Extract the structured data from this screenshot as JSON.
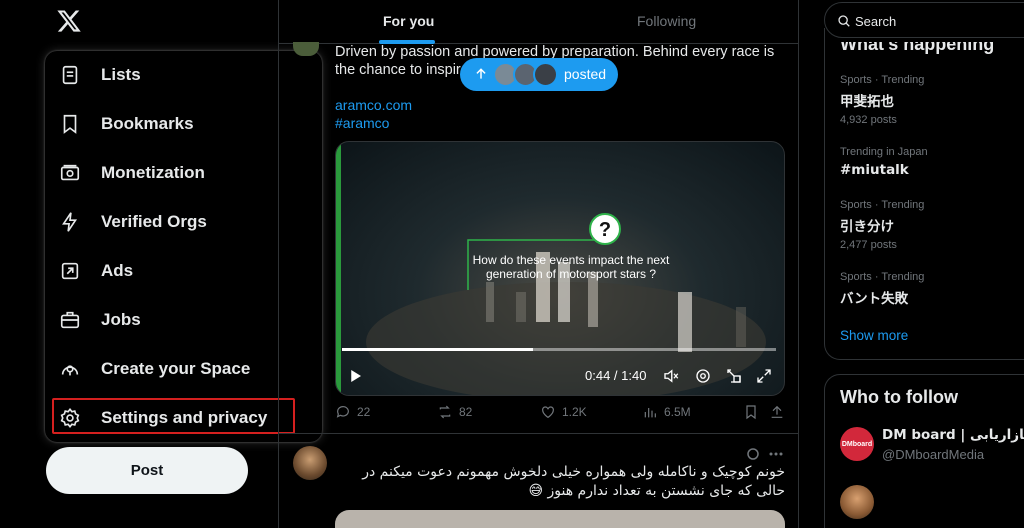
{
  "menu": {
    "items": [
      {
        "label": "Lists",
        "icon": "list-icon"
      },
      {
        "label": "Bookmarks",
        "icon": "bookmark-icon"
      },
      {
        "label": "Monetization",
        "icon": "money-icon"
      },
      {
        "label": "Verified Orgs",
        "icon": "lightning-icon"
      },
      {
        "label": "Ads",
        "icon": "external-arrow-icon"
      },
      {
        "label": "Jobs",
        "icon": "briefcase-icon"
      },
      {
        "label": "Create your Space",
        "icon": "space-icon"
      },
      {
        "label": "Settings and privacy",
        "icon": "gear-icon"
      }
    ],
    "highlighted_item": "Settings and privacy"
  },
  "post_button_label": "Post",
  "tabs": {
    "for_you": "For you",
    "following": "Following",
    "active": "For you"
  },
  "tweet1": {
    "text": "Driven by passion and powered by preparation. Behind every race is the chance to inspire the",
    "link1": "aramco.com",
    "link2": "#aramco",
    "video": {
      "caption": "How do these events impact the next generation of motorsport stars ?",
      "time": "0:44 / 1:40",
      "progress_fraction": 0.44
    },
    "stats": {
      "replies": "22",
      "reposts": "82",
      "likes": "1.2K",
      "views": "6.5M"
    }
  },
  "posted_pill": {
    "label": "posted"
  },
  "tweet2": {
    "text": "خونم کوچیک و ناکامله ولی همواره خیلی دلخوش مهمونم دعوت میکنم در حالی که جای نشستن به تعداد ندارم هنوز 😅"
  },
  "search": {
    "placeholder": "Search"
  },
  "whats_happening": {
    "title": "What's happening",
    "trends": [
      {
        "meta": "Sports · Trending",
        "name": "甲斐拓也",
        "count": "4,932 posts"
      },
      {
        "meta": "Trending in Japan",
        "name": "#miutalk",
        "count": ""
      },
      {
        "meta": "Sports · Trending",
        "name": "引き分け",
        "count": "2,477 posts"
      },
      {
        "meta": "Sports · Trending",
        "name": "バント失敗",
        "count": ""
      }
    ],
    "show_more": "Show more"
  },
  "who_to_follow": {
    "title": "Who to follow",
    "accounts": [
      {
        "name": "DM board | سانه بازاریابی",
        "handle": "@DMboardMedia",
        "avatar_text": "DMboard"
      }
    ]
  },
  "colors": {
    "accent": "#1d9bf0",
    "highlight_box": "#d5201f",
    "background": "#000000",
    "border": "#2f3336",
    "muted_text": "#71767b"
  }
}
